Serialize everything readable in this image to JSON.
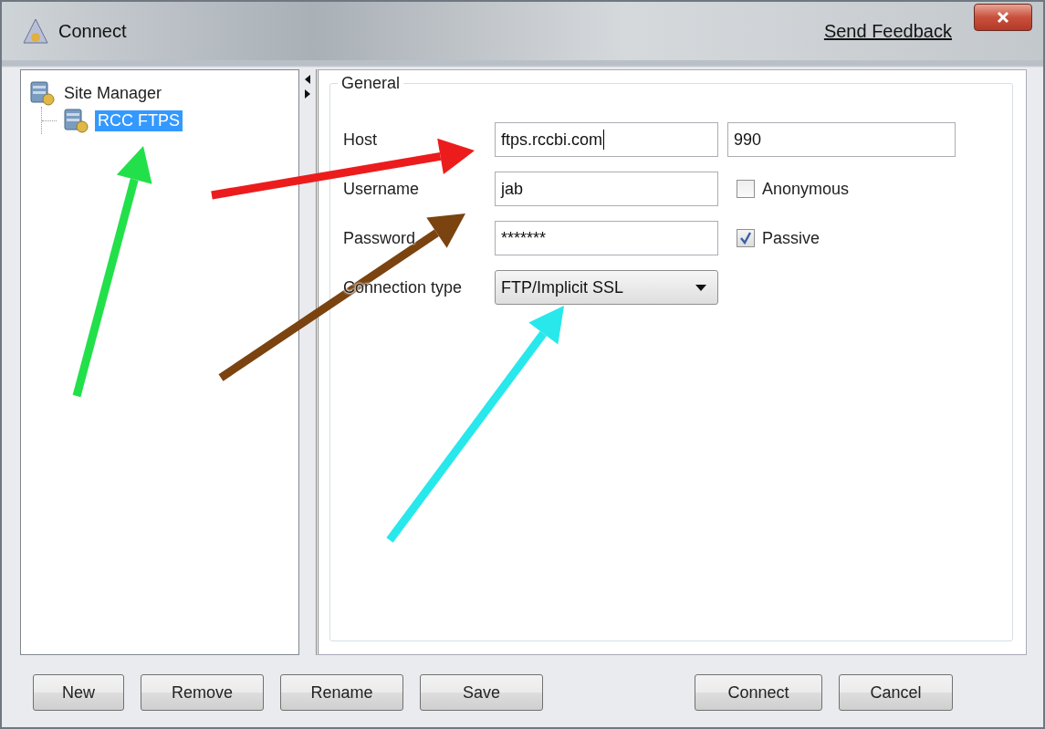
{
  "window": {
    "title": "Connect",
    "link": "Send Feedback"
  },
  "tree": [
    {
      "label": "Site Manager",
      "selected": false,
      "children": [
        {
          "label": "RCC FTPS",
          "selected": true
        }
      ]
    }
  ],
  "general": {
    "title": "General",
    "host": {
      "label": "Host",
      "value": "ftps.rccbi.com",
      "port": "990"
    },
    "username": {
      "label": "Username",
      "value": "jab"
    },
    "password": {
      "label": "Password",
      "value": "*******"
    },
    "anonymous": {
      "label": "Anonymous",
      "checked": false
    },
    "passive": {
      "label": "Passive",
      "checked": true
    },
    "connection_type": {
      "label": "Connection type",
      "value": "FTP/Implicit SSL"
    }
  },
  "left_buttons": [
    "New",
    "Remove",
    "Rename",
    "Save"
  ],
  "right_buttons": [
    "Connect",
    "Cancel"
  ]
}
